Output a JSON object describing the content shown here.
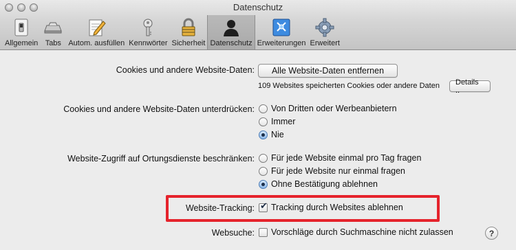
{
  "window": {
    "title": "Datenschutz"
  },
  "toolbar": {
    "items": [
      {
        "label": "Allgemein",
        "icon": "switch-icon"
      },
      {
        "label": "Tabs",
        "icon": "tabs-icon"
      },
      {
        "label": "Autom. ausfüllen",
        "icon": "pencil-form-icon"
      },
      {
        "label": "Kennwörter",
        "icon": "key-icon"
      },
      {
        "label": "Sicherheit",
        "icon": "padlock-icon"
      },
      {
        "label": "Datenschutz",
        "icon": "silhouette-icon",
        "selected": true
      },
      {
        "label": "Erweiterungen",
        "icon": "puzzle-icon"
      },
      {
        "label": "Erweitert",
        "icon": "gear-icon"
      }
    ]
  },
  "cookies": {
    "label": "Cookies und andere Website-Daten:",
    "remove_button": "Alle Website-Daten entfernen",
    "note": "109 Websites speicherten Cookies oder andere Daten",
    "details_button": "Details .."
  },
  "block_cookies": {
    "label": "Cookies und andere Website-Daten unterdrücken:",
    "options": [
      "Von Dritten oder Werbeanbietern",
      "Immer",
      "Nie"
    ],
    "selected": 2
  },
  "location": {
    "label": "Website-Zugriff auf Ortungsdienste beschränken:",
    "options": [
      "Für jede Website einmal pro Tag fragen",
      "Für jede Website nur einmal fragen",
      "Ohne Bestätigung ablehnen"
    ],
    "selected": 2
  },
  "tracking": {
    "label": "Website-Tracking:",
    "checkbox_label": "Tracking durch Websites ablehnen",
    "checked": true
  },
  "websearch": {
    "label": "Websuche:",
    "checkbox_label": "Vorschläge durch Suchmaschine nicht zulassen",
    "checked": false
  },
  "help": {
    "label": "?"
  },
  "colors": {
    "highlight": "#e5232c"
  }
}
